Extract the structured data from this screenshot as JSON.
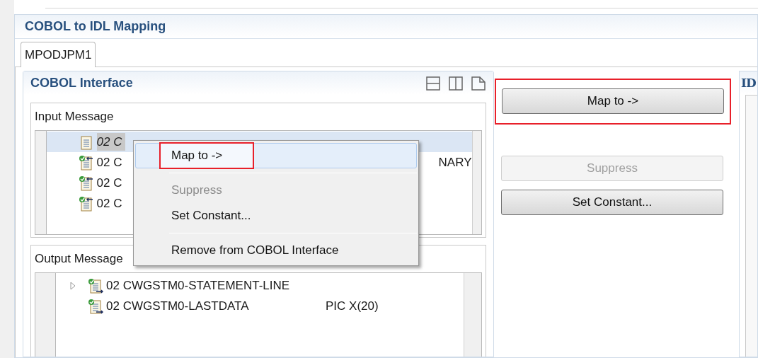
{
  "editor": {
    "title": "COBOL to IDL Mapping"
  },
  "tabs": [
    {
      "label": "MPODJPM1",
      "selected": true
    }
  ],
  "cobol_panel": {
    "title": "COBOL Interface",
    "input_message": {
      "title": "Input Message",
      "rows": [
        {
          "kind": "unmapped",
          "label": "02 C",
          "column_2": "",
          "selected": true
        },
        {
          "kind": "mapped",
          "label": "02 C",
          "column_2": "NARY",
          "selected": false
        },
        {
          "kind": "mapped",
          "label": "02 C",
          "column_2": "",
          "selected": false
        },
        {
          "kind": "mapped",
          "label": "02 C",
          "column_2": "",
          "selected": false
        }
      ]
    },
    "output_message": {
      "title": "Output Message",
      "rows": [
        {
          "kind": "group",
          "label": "02 CWGSTM0-STATEMENT-LINE",
          "column_2": "",
          "expanded": false
        },
        {
          "kind": "field",
          "label": "02 CWGSTM0-LASTDATA",
          "column_2": "PIC X(20)"
        }
      ]
    }
  },
  "actions": [
    {
      "label": "Map to ->",
      "disabled": false,
      "highlighted": true
    },
    {
      "label": "Suppress",
      "disabled": true,
      "highlighted": false
    },
    {
      "label": "Set Constant...",
      "disabled": false,
      "highlighted": false
    }
  ],
  "idl_panel": {
    "title": "ID"
  },
  "context_menu": {
    "items": [
      {
        "kind": "item",
        "label": "Map to ->",
        "disabled": false,
        "selected": true,
        "highlighted": true
      },
      {
        "kind": "separator"
      },
      {
        "kind": "item",
        "label": "Suppress",
        "disabled": true,
        "selected": false,
        "highlighted": false
      },
      {
        "kind": "item",
        "label": "Set Constant...",
        "disabled": false,
        "selected": false,
        "highlighted": false
      },
      {
        "kind": "separator"
      },
      {
        "kind": "item",
        "label": "Remove from COBOL Interface",
        "disabled": false,
        "selected": false,
        "highlighted": false
      }
    ]
  }
}
